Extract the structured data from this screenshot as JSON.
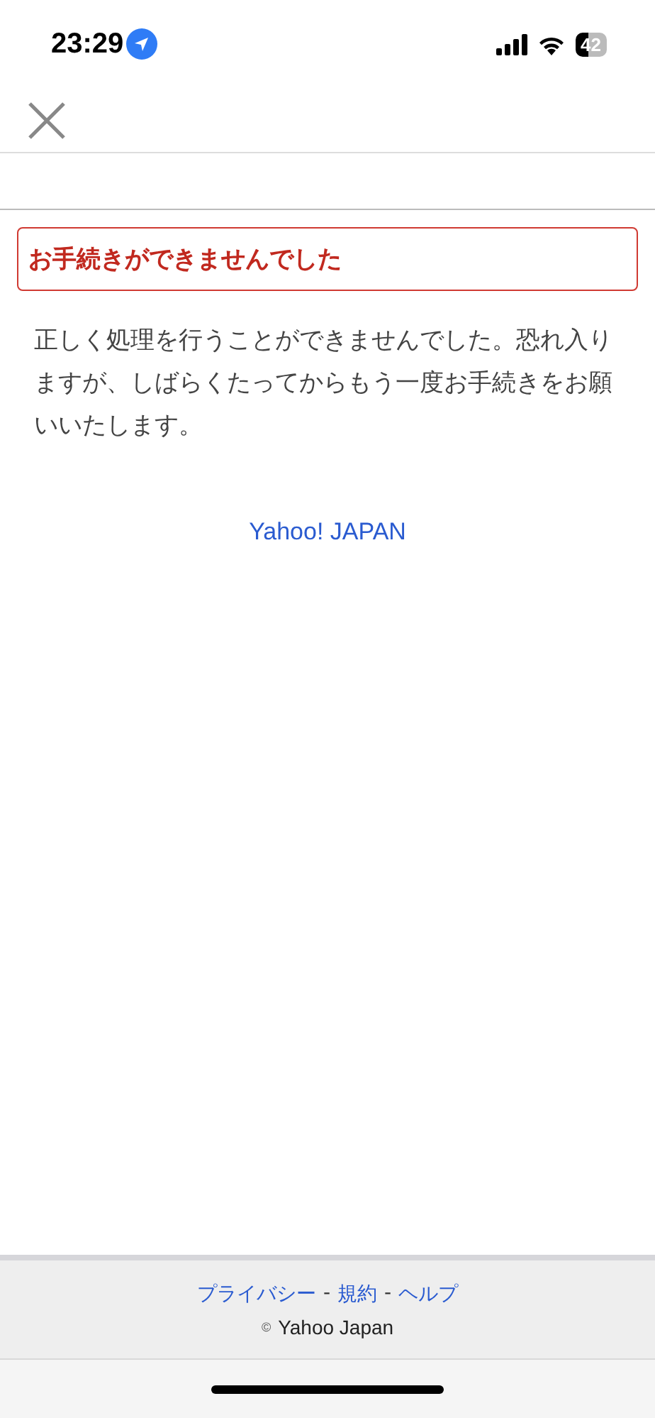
{
  "status_bar": {
    "time": "23:29",
    "battery": "42"
  },
  "error": {
    "title": "お手続きができませんでした",
    "message": "正しく処理を行うことができませんでした。恐れ入りますが、しばらくたってからもう一度お手続きをお願いいたします。"
  },
  "home_link": "Yahoo! JAPAN",
  "footer": {
    "links": [
      {
        "label": "プライバシー"
      },
      {
        "label": "規約"
      },
      {
        "label": "ヘルプ"
      }
    ],
    "separator": "-",
    "copyright_mark": "©",
    "copyright": "Yahoo Japan"
  }
}
